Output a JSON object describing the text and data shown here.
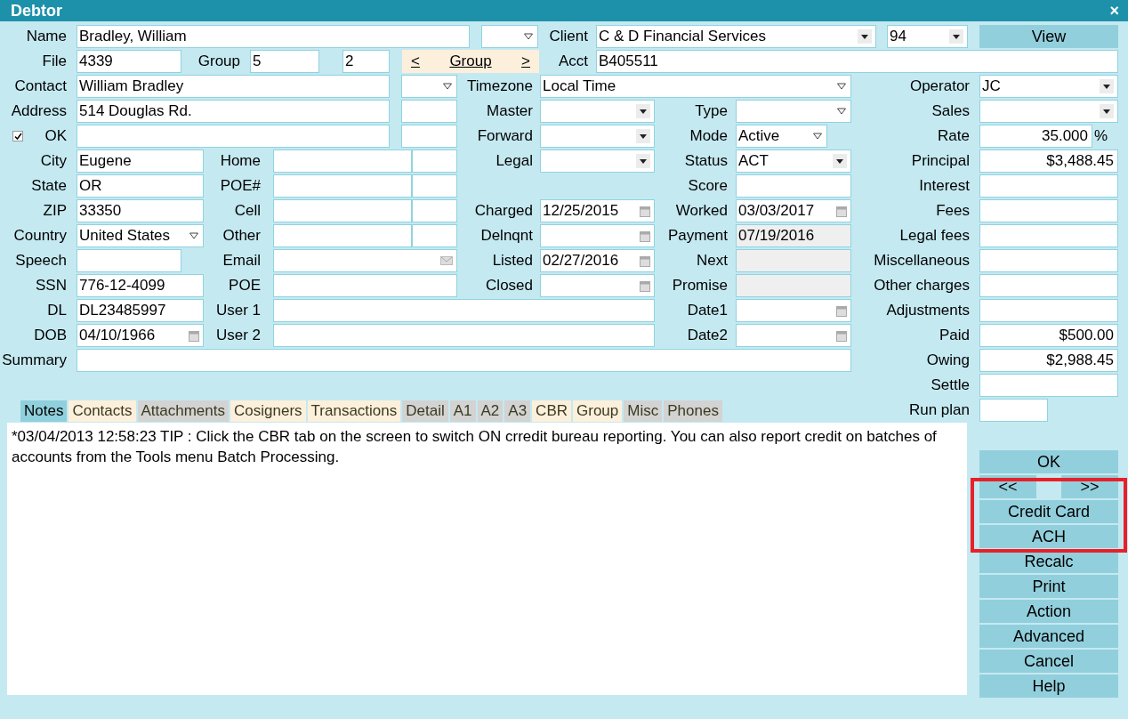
{
  "window": {
    "title": "Debtor",
    "close": "×"
  },
  "form_rows": [
    [
      {
        "kind": "label",
        "text": "Name"
      },
      {
        "kind": "text",
        "value": "Bradley, William",
        "disabled": false
      },
      {
        "kind": "combo"
      },
      {
        "kind": "label",
        "text": "Client"
      },
      {
        "kind": "select",
        "value": "C & D Financial Services"
      },
      {
        "kind": "select",
        "value": "94"
      },
      {
        "kind": "button",
        "text": "View"
      }
    ],
    [
      {
        "kind": "label",
        "text": "File"
      },
      {
        "kind": "text",
        "value": "4339",
        "disabled": false
      },
      {
        "kind": "label",
        "text": "Group"
      },
      {
        "kind": "text",
        "value": "5",
        "disabled": false
      },
      {
        "kind": "text",
        "value": "2",
        "disabled": false
      },
      {
        "kind": "nav",
        "prev": "<",
        "text": "Group",
        "next": ">"
      },
      {
        "kind": "label",
        "text": "Acct"
      },
      {
        "kind": "text",
        "value": "B405511",
        "disabled": false
      }
    ],
    [
      {
        "kind": "label",
        "text": "Contact"
      },
      {
        "kind": "text",
        "value": "William Bradley",
        "disabled": false
      },
      {
        "kind": "combo"
      },
      {
        "kind": "label",
        "text": "Timezone"
      },
      {
        "kind": "combo",
        "value": "Local Time"
      },
      {
        "kind": "label",
        "text": "Operator"
      },
      {
        "kind": "select",
        "value": "JC"
      }
    ],
    [
      {
        "kind": "label",
        "text": "Address"
      },
      {
        "kind": "text",
        "value": "514 Douglas Rd.",
        "disabled": false
      },
      {
        "kind": "text",
        "disabled": false
      },
      {
        "kind": "label",
        "text": "Master"
      },
      {
        "kind": "select"
      },
      {
        "kind": "label",
        "text": "Type"
      },
      {
        "kind": "combo"
      },
      {
        "kind": "label",
        "text": "Sales"
      },
      {
        "kind": "select"
      }
    ],
    [
      {
        "kind": "check",
        "checked": true
      },
      {
        "kind": "label",
        "text": "OK"
      },
      {
        "kind": "text",
        "disabled": false
      },
      {
        "kind": "text",
        "disabled": false
      },
      {
        "kind": "label",
        "text": "Forward"
      },
      {
        "kind": "select"
      },
      {
        "kind": "label",
        "text": "Mode"
      },
      {
        "kind": "combo",
        "value": "Active"
      },
      {
        "kind": "label",
        "text": "Rate"
      },
      {
        "kind": "amount",
        "value": "35.000",
        "disabled": false
      },
      {
        "kind": "unit",
        "text": "%"
      }
    ],
    [
      {
        "kind": "label",
        "text": "City"
      },
      {
        "kind": "text",
        "value": "Eugene",
        "disabled": false
      },
      {
        "kind": "label",
        "text": "Home"
      },
      {
        "kind": "text",
        "disabled": false
      },
      {
        "kind": "text",
        "disabled": false
      },
      {
        "kind": "label",
        "text": "Legal"
      },
      {
        "kind": "select"
      },
      {
        "kind": "label",
        "text": "Status"
      },
      {
        "kind": "select",
        "value": "ACT"
      },
      {
        "kind": "label",
        "text": "Principal"
      },
      {
        "kind": "amount",
        "value": "$3,488.45",
        "disabled": false
      }
    ],
    [
      {
        "kind": "label",
        "text": "State"
      },
      {
        "kind": "text",
        "value": "OR",
        "disabled": false
      },
      {
        "kind": "label",
        "text": "POE#"
      },
      {
        "kind": "text",
        "disabled": false
      },
      {
        "kind": "text",
        "disabled": false
      },
      {
        "kind": "label",
        "text": "Score"
      },
      {
        "kind": "text",
        "disabled": false
      },
      {
        "kind": "label",
        "text": "Interest"
      },
      {
        "kind": "amount",
        "disabled": false
      }
    ],
    [
      {
        "kind": "label",
        "text": "ZIP"
      },
      {
        "kind": "text",
        "value": "33350",
        "disabled": false
      },
      {
        "kind": "label",
        "text": "Cell"
      },
      {
        "kind": "text",
        "disabled": false
      },
      {
        "kind": "text",
        "disabled": false
      },
      {
        "kind": "label",
        "text": "Charged"
      },
      {
        "kind": "date",
        "value": "12/25/2015",
        "disabled": false
      },
      {
        "kind": "label",
        "text": "Worked"
      },
      {
        "kind": "date",
        "value": "03/03/2017",
        "disabled": false
      },
      {
        "kind": "label",
        "text": "Fees"
      },
      {
        "kind": "amount",
        "disabled": false
      }
    ],
    [
      {
        "kind": "label",
        "text": "Country"
      },
      {
        "kind": "combo",
        "value": "United States"
      },
      {
        "kind": "label",
        "text": "Other"
      },
      {
        "kind": "text",
        "disabled": false
      },
      {
        "kind": "text",
        "disabled": false
      },
      {
        "kind": "label",
        "text": "Delnqnt"
      },
      {
        "kind": "date",
        "disabled": false
      },
      {
        "kind": "label",
        "text": "Payment"
      },
      {
        "kind": "text",
        "value": "07/19/2016",
        "disabled": true
      },
      {
        "kind": "label",
        "text": "Legal fees"
      },
      {
        "kind": "amount",
        "disabled": false
      }
    ],
    [
      {
        "kind": "label",
        "text": "Speech"
      },
      {
        "kind": "text",
        "disabled": false
      },
      {
        "kind": "label",
        "text": "Email"
      },
      {
        "kind": "email",
        "disabled": false
      },
      {
        "kind": "label",
        "text": "Listed"
      },
      {
        "kind": "date",
        "value": "02/27/2016",
        "disabled": false
      },
      {
        "kind": "label",
        "text": "Next"
      },
      {
        "kind": "text",
        "disabled": true
      },
      {
        "kind": "label",
        "text": "Miscellaneous"
      },
      {
        "kind": "amount",
        "disabled": false
      }
    ],
    [
      {
        "kind": "label",
        "text": "SSN"
      },
      {
        "kind": "text",
        "value": "776-12-4099",
        "disabled": false
      },
      {
        "kind": "label",
        "text": "POE"
      },
      {
        "kind": "text",
        "disabled": false
      },
      {
        "kind": "label",
        "text": "Closed"
      },
      {
        "kind": "date",
        "disabled": false
      },
      {
        "kind": "label",
        "text": "Promise"
      },
      {
        "kind": "text",
        "disabled": true
      },
      {
        "kind": "label",
        "text": "Other charges"
      },
      {
        "kind": "amount",
        "disabled": false
      }
    ],
    [
      {
        "kind": "label",
        "text": "DL"
      },
      {
        "kind": "text",
        "value": "DL23485997",
        "disabled": false
      },
      {
        "kind": "label",
        "text": "User 1"
      },
      {
        "kind": "text",
        "disabled": false
      },
      {
        "kind": "label",
        "text": "Date1"
      },
      {
        "kind": "date",
        "disabled": false
      },
      {
        "kind": "label",
        "text": "Adjustments"
      },
      {
        "kind": "amount",
        "disabled": false
      }
    ],
    [
      {
        "kind": "label",
        "text": "DOB"
      },
      {
        "kind": "date",
        "value": "04/10/1966",
        "disabled": false
      },
      {
        "kind": "label",
        "text": "User 2"
      },
      {
        "kind": "text",
        "disabled": false
      },
      {
        "kind": "label",
        "text": "Date2"
      },
      {
        "kind": "date",
        "disabled": false
      },
      {
        "kind": "label",
        "text": "Paid"
      },
      {
        "kind": "amount",
        "value": "$500.00",
        "disabled": false
      }
    ],
    [
      {
        "kind": "label",
        "text": "Summary"
      },
      {
        "kind": "text",
        "disabled": false
      },
      {
        "kind": "label",
        "text": "Owing"
      },
      {
        "kind": "amount",
        "value": "$2,988.45",
        "disabled": false
      }
    ],
    [
      {
        "kind": "label",
        "text": "Settle"
      },
      {
        "kind": "amount",
        "disabled": false
      }
    ],
    [
      {
        "kind": "label",
        "text": "Run plan"
      },
      {
        "kind": "text",
        "disabled": false
      }
    ]
  ],
  "tabs": [
    {
      "label": "Notes",
      "selected": true,
      "color": "#8fd0dc"
    },
    {
      "label": "Contacts",
      "selected": false,
      "color": "#fcf0dc"
    },
    {
      "label": "Attachments",
      "selected": false,
      "color": "#d3d3d3"
    },
    {
      "label": "Cosigners",
      "selected": false,
      "color": "#fcf0dc"
    },
    {
      "label": "Transactions",
      "selected": false,
      "color": "#fcf0dc"
    },
    {
      "label": "Detail",
      "selected": false,
      "color": "#d3d3d3"
    },
    {
      "label": "A1",
      "selected": false,
      "color": "#d3d3d3"
    },
    {
      "label": "A2",
      "selected": false,
      "color": "#d3d3d3"
    },
    {
      "label": "A3",
      "selected": false,
      "color": "#d3d3d3"
    },
    {
      "label": "CBR",
      "selected": false,
      "color": "#fcf0dc"
    },
    {
      "label": "Group",
      "selected": false,
      "color": "#fcf0dc"
    },
    {
      "label": "Misc",
      "selected": false,
      "color": "#d3d3d3"
    },
    {
      "label": "Phones",
      "selected": false,
      "color": "#d3d3d3"
    }
  ],
  "notes": "*03/04/2013 12:58:23 TIP : Click the CBR tab on the screen to switch ON crredit bureau reporting. You can also report credit on batches of accounts from the Tools menu Batch Processing.",
  "buttons": [
    {
      "kind": "single",
      "label": "OK"
    },
    {
      "kind": "pair",
      "left": "<<",
      "right": ">>"
    },
    {
      "kind": "single",
      "label": "Credit Card"
    },
    {
      "kind": "single",
      "label": "ACH"
    },
    {
      "kind": "single",
      "label": "Recalc"
    },
    {
      "kind": "single",
      "label": "Print"
    },
    {
      "kind": "single",
      "label": "Action"
    },
    {
      "kind": "single",
      "label": "Advanced"
    },
    {
      "kind": "single",
      "label": "Cancel"
    },
    {
      "kind": "single",
      "label": "Help"
    }
  ],
  "annotation": {
    "kind": "rectangle"
  }
}
